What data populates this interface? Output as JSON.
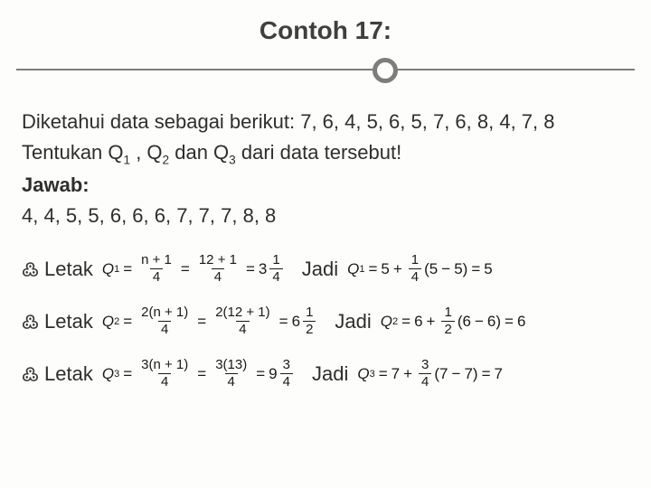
{
  "title": "Contoh 17:",
  "body": {
    "line1_a": "Diketahui data sebagai berikut: ",
    "line1_b": "7, 6, 4, 5, 6, 5, 7, 6, 8, 4, 7, 8",
    "line2_a": "Tentukan Q",
    "line2_b": " , Q",
    "line2_c": " dan Q",
    "line2_d": " dari data tersebut!",
    "sub1": "1",
    "sub2": "2",
    "sub3": "3",
    "jawab": "Jawab:",
    "sorted": "4, 4, 5, 5, 6, 6, 6, 7, 7, 7, 8, 8"
  },
  "labels": {
    "letak": "Letak",
    "jadi": "Jadi"
  },
  "q1": {
    "sym": "Q",
    "sub": "1",
    "f1num": "n + 1",
    "f1den": "4",
    "f2num": "12 + 1",
    "f2den": "4",
    "res_int": "3",
    "res_fracnum": "1",
    "res_fracden": "4",
    "val_a": "5",
    "val_fracnum": "1",
    "val_fracden": "4",
    "val_paren_a": "5",
    "val_paren_b": "5",
    "val_eq": "5"
  },
  "q2": {
    "sym": "Q",
    "sub": "2",
    "f1num": "2(n + 1)",
    "f1den": "4",
    "f2num": "2(12 + 1)",
    "f2den": "4",
    "res_int": "6",
    "res_fracnum": "1",
    "res_fracden": "2",
    "val_a": "6",
    "val_fracnum": "1",
    "val_fracden": "2",
    "val_paren_a": "6",
    "val_paren_b": "6",
    "val_eq": "6"
  },
  "q3": {
    "sym": "Q",
    "sub": "3",
    "f1num": "3(n + 1)",
    "f1den": "4",
    "f2num": "3(13)",
    "f2den": "4",
    "res_int": "9",
    "res_fracnum": "3",
    "res_fracden": "4",
    "val_a": "7",
    "val_fracnum": "3",
    "val_fracden": "4",
    "val_paren_a": "7",
    "val_paren_b": "7",
    "val_eq": "7"
  }
}
